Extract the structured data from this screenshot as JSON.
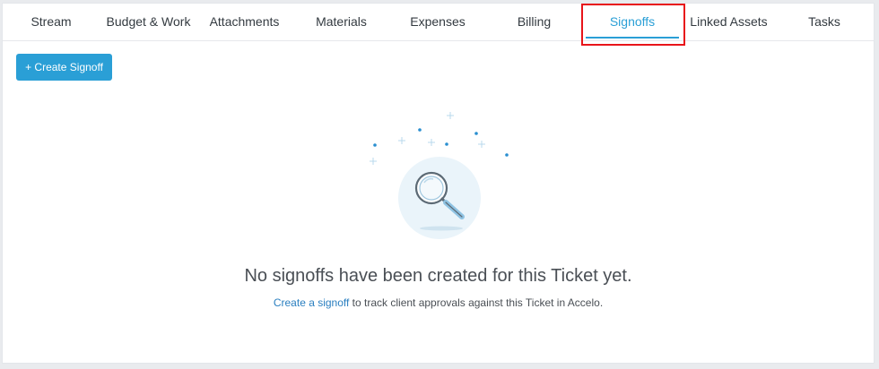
{
  "tabs": [
    {
      "label": "Stream"
    },
    {
      "label": "Budget & Work"
    },
    {
      "label": "Attachments"
    },
    {
      "label": "Materials"
    },
    {
      "label": "Expenses"
    },
    {
      "label": "Billing"
    },
    {
      "label": "Signoffs",
      "active": true
    },
    {
      "label": "Linked Assets"
    },
    {
      "label": "Tasks"
    }
  ],
  "toolbar": {
    "create_signoff_label": "+ Create Signoff"
  },
  "empty_state": {
    "icon": "magnifying-glass-icon",
    "title": "No signoffs have been created for this Ticket yet.",
    "link_text": "Create a signoff",
    "description": " to track client approvals against this Ticket in Accelo."
  },
  "colors": {
    "accent": "#2a9fd6",
    "highlight": "#e8141a",
    "text": "#4a4f55"
  }
}
